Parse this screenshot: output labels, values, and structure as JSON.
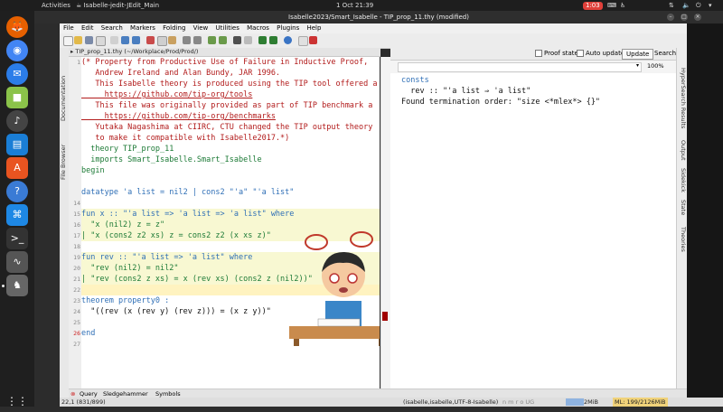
{
  "topbar": {
    "activities": "Activities",
    "app_name": "Isabelle-jedit-JEdit_Main",
    "clock": "1 Oct  21:39",
    "record_time": "1:03"
  },
  "window": {
    "title": "Isabelle2023/Smart_Isabelle - TIP_prop_11.thy (modified)"
  },
  "menubar": [
    "File",
    "Edit",
    "Search",
    "Markers",
    "Folding",
    "View",
    "Utilities",
    "Macros",
    "Plugins",
    "Help"
  ],
  "left_dock_tabs": [
    "Documentation",
    "File Browser"
  ],
  "editor": {
    "tab_label": "TIP_prop_11.thy (~/Workplace/Prod/Prod/)",
    "line_numbers": [
      "1",
      "",
      "",
      "",
      "",
      "",
      "",
      "",
      "",
      "",
      "",
      "",
      "",
      "14",
      "15",
      "16",
      "17",
      "18",
      "19",
      "20",
      "21",
      "22",
      "23",
      "24",
      "25",
      "26",
      "27"
    ],
    "lines": [
      "(* Property from Productive Use of Failure in Inductive Proof,",
      "   Andrew Ireland and Alan Bundy, JAR 1996.",
      "   This Isabelle theory is produced using the TIP tool offered a",
      "     https://github.com/tip-org/tools",
      "   This file was originally provided as part of TIP benchmark a",
      "     https://github.com/tip-org/benchmarks",
      "   Yutaka Nagashima at CIIRC, CTU changed the TIP output theory",
      "   to make it compatible with Isabelle2017.*)",
      "  theory TIP_prop_11",
      "  imports Smart_Isabelle.Smart_Isabelle",
      "begin",
      "",
      "datatype 'a list = nil2 | cons2 \"'a\" \"'a list\"",
      "",
      "fun x :: \"'a list => 'a list => 'a list\" where",
      "  \"x (nil2) z = z\"",
      "| \"x (cons2 z2 xs) z = cons2 z2 (x xs z)\"",
      "",
      "fun rev :: \"'a list => 'a list\" where",
      "  \"rev (nil2) = nil2\"",
      "| \"rev (cons2 z xs) = x (rev xs) (cons2 z (nil2))\"",
      "",
      "theorem property0 :",
      "  \"((rev (x (rev y) (rev z))) = (x z y))\"",
      "",
      "end",
      ""
    ]
  },
  "output": {
    "proof_state_label": "Proof state",
    "auto_update_label": "Auto update",
    "update_button": "Update",
    "search_label": "Search:",
    "zoom": "100%",
    "lines": [
      "consts",
      "  rev :: \"'a list ⇒ 'a list\"",
      "Found termination order: \"size <*mlex*> {}\""
    ]
  },
  "right_dock_tabs": [
    "HyperSearch Results",
    "Output",
    "Sidekick",
    "State",
    "Theories"
  ],
  "bottom_tabs": [
    "Query",
    "Sledgehammer",
    "Symbols"
  ],
  "statusbar": {
    "position": "22,1 (831/899)",
    "mode": "(isabelle,isabelle,UTF-8-Isabelle)",
    "flags": "n m r o UG",
    "memory": "2MiB",
    "ml": "ML: 199/2126MiB",
    "time": "21:38"
  },
  "colors": {
    "comment": "#b21b1b",
    "keyword": "#1c7a36",
    "type_var": "#8e1aa5"
  }
}
